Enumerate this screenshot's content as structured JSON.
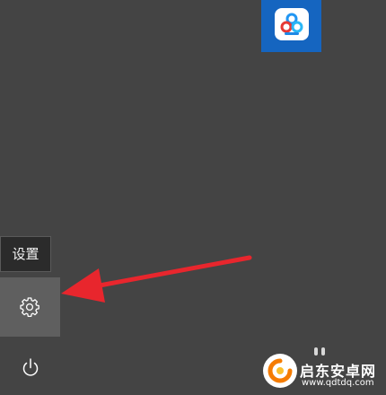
{
  "start_menu": {
    "app_tile": {
      "icon": "baidu-netdisk-icon",
      "color": "#1565c0"
    },
    "settings_tooltip": "设置",
    "settings_button": {
      "icon": "gear-icon"
    },
    "power_button": {
      "icon": "power-icon"
    }
  },
  "annotation": {
    "type": "arrow",
    "color": "#e8262d",
    "points_to": "settings-button"
  },
  "watermark": {
    "title": "启东安卓网",
    "url": "www.qdtdq.com"
  }
}
